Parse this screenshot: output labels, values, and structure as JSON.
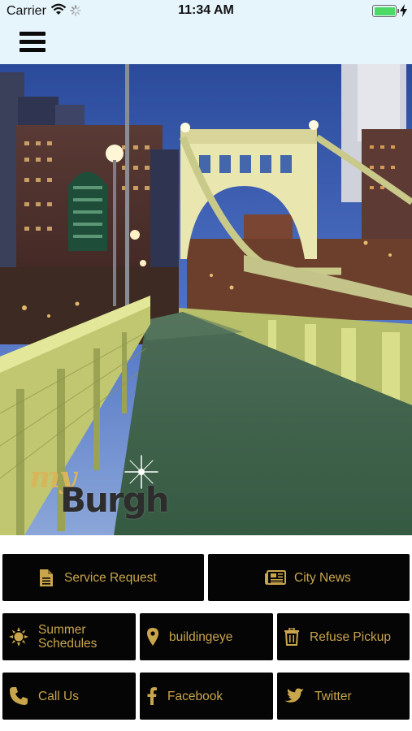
{
  "status_bar": {
    "carrier": "Carrier",
    "time": "11:34 AM",
    "battery_level": 1.0,
    "battery_color": "#4cd964"
  },
  "header": {
    "menu_icon": "hamburger-menu-icon",
    "background": "#e6f4fc"
  },
  "hero": {
    "image": "pittsburgh-bridge-photo",
    "logo_script": "my",
    "logo_word": "Burgh"
  },
  "buttons": {
    "service_request": {
      "label": "Service Request",
      "icon": "document-icon"
    },
    "city_news": {
      "label": "City News",
      "icon": "newspaper-icon"
    },
    "summer_schedules": {
      "label": "Summer Schedules",
      "line1": "Summer",
      "line2": "Schedules",
      "icon": "sun-icon"
    },
    "buildingeye": {
      "label": "buildingeye",
      "icon": "map-pin-icon"
    },
    "refuse_pickup": {
      "label": "Refuse Pickup",
      "icon": "trash-icon"
    },
    "call_us": {
      "label": "Call Us",
      "icon": "phone-icon"
    },
    "facebook": {
      "label": "Facebook",
      "icon": "facebook-icon"
    },
    "twitter": {
      "label": "Twitter",
      "icon": "twitter-icon"
    }
  },
  "colors": {
    "button_bg": "#050505",
    "button_text": "#c9a54b",
    "logo_gold": "#d7b65b"
  }
}
